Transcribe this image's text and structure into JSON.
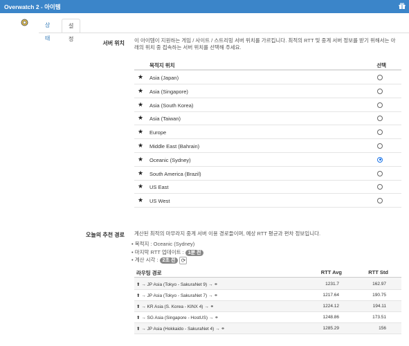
{
  "window": {
    "title": "Overwatch 2 - 아이템"
  },
  "tabs": [
    {
      "label": "상태"
    },
    {
      "label": "설정"
    }
  ],
  "server_section": {
    "label": "서버 위치",
    "description": "이 아이템이 지원하는 게임 / 사이트 / 스트리밍 서버 위치를 가르킵니다. 최적의 RTT 및 중계 서버 정보를 받기 위해서는 아래의 위치 중 접속하는 서버 위치를 선택해 주세요.",
    "col_destination": "목적지 위치",
    "col_select": "선택",
    "selected_index": 6,
    "servers": [
      {
        "name": "Asia (Japan)"
      },
      {
        "name": "Asia (Singapore)"
      },
      {
        "name": "Asia (South Korea)"
      },
      {
        "name": "Asia (Taiwan)"
      },
      {
        "name": "Europe"
      },
      {
        "name": "Middle East (Bahrain)"
      },
      {
        "name": "Oceanic (Sydney)"
      },
      {
        "name": "South America (Brazil)"
      },
      {
        "name": "US East"
      },
      {
        "name": "US West"
      }
    ]
  },
  "route_section": {
    "label": "오늘의 추천 경로",
    "description": "계산된 최적의 마무라지 중계 서버 이용 경로들이며, 예상 RTT 평균과 편차 정보입니다.",
    "destination_text": "목적지 : Oceanic (Sydney)",
    "last_update_label": "마지막 RTT 업데이트 :",
    "last_update_badge": "1분 전",
    "calc_time_label": "계산 시각 :",
    "calc_time_badge": "2초 전",
    "col_route": "라우팅 경로",
    "col_avg": "RTT Avg",
    "col_std": "RTT Std",
    "routes": [
      {
        "route": "⬆ → JP Asia (Tokyo - SakuraNet 9) → ⚭",
        "avg": "1231.7",
        "std": "162.97"
      },
      {
        "route": "⬆ → JP Asia (Tokyo - SakuraNet 7) → ⚭",
        "avg": "1217.64",
        "std": "190.75"
      },
      {
        "route": "⬆ → KR Asia (S. Korea - KINX 4) → ⚭",
        "avg": "1224.12",
        "std": "194.11"
      },
      {
        "route": "⬆ → SG Asia (Singapore - HostUS) → ⚭",
        "avg": "1248.86",
        "std": "173.51"
      },
      {
        "route": "⬆ → JP Asia (Hokkaido - SakuraNet 4) → ⚭",
        "avg": "1285.29",
        "std": "156"
      }
    ]
  },
  "icons": {
    "titlebar_right": "gift-icon",
    "app": "gear-globe-icon",
    "row_mark": "star-icon",
    "refresh": "refresh-icon"
  },
  "colors": {
    "titlebar": "#3b85c9",
    "link": "#337ab7",
    "radio_selected": "#1a73e8"
  }
}
